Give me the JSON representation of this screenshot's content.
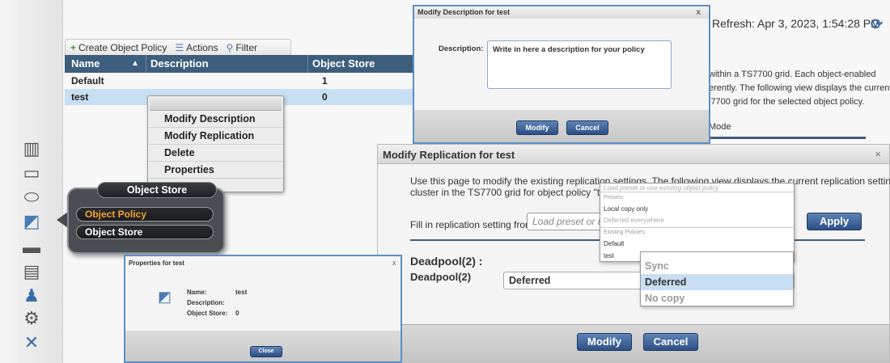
{
  "left_nav": {
    "icons": [
      "cluster-icon",
      "monitor-icon",
      "disk-icon",
      "object-store-icon",
      "tape-drive-icon",
      "clipboard-icon",
      "user-icon",
      "gears-icon",
      "tools-icon"
    ],
    "glyphs": [
      "▥",
      "▭",
      "⬭",
      "◩",
      "▬",
      "▤",
      "♟",
      "⚙",
      "✕"
    ]
  },
  "toolbar": {
    "create_label": "Create Object Policy",
    "actions_label": "Actions",
    "filter_label": "Filter",
    "create_glyph": "+",
    "actions_glyph": "☰",
    "filter_glyph": "⚲"
  },
  "grid": {
    "columns": [
      "Name",
      "Description",
      "Object Store"
    ],
    "sort_glyph": "▲",
    "rows": [
      {
        "name": "Default",
        "description": "",
        "object_store": "1"
      },
      {
        "name": "test",
        "description": "",
        "object_store": "0"
      }
    ]
  },
  "context_menu": {
    "items": [
      "Modify Description",
      "Modify Replication",
      "Delete",
      "Properties"
    ]
  },
  "object_store_popup": {
    "title": "Object Store",
    "items": [
      "Object Policy",
      "Object Store"
    ],
    "active_color": "#f2a531"
  },
  "background_panel": {
    "refresh_text": "Refresh:  Apr 3, 2023, 1:54:28 PM",
    "refresh_glyph": "⟳",
    "line1": "within a TS7700 grid. Each object-enabled",
    "line2": "erently. The following view displays the current",
    "line3": "i7700 grid for the selected object policy.",
    "mode_label": "Mode"
  },
  "modify_description_dialog": {
    "title": "Modify Description for test",
    "close_glyph": "x",
    "label": "Description:",
    "value": "Write in here a description for your policy",
    "modify_label": "Modify",
    "cancel_label": "Cancel"
  },
  "modify_replication_dialog": {
    "title": "Modify Replication for test",
    "close_glyph": "×",
    "intro_line1": "Use this page to modify the existing replication settings. The following view displays the current replication settings for each",
    "intro_line2": "cluster in the TS7700 grid for object policy \"test\"",
    "fill_label": "Fill in replication setting from",
    "fill_placeholder": "Load preset or use",
    "apply_label": "Apply",
    "cluster_title": "Deadpool(2) :",
    "cluster_label": "Deadpool(2)",
    "cluster_value": "Deferred",
    "modify_label": "Modify",
    "cancel_label": "Cancel"
  },
  "preset_dropdown": {
    "hint": "Load preset or use existing object policy",
    "presets_header": "Presets:",
    "presets": [
      "Local copy only",
      "Deferred everywhere"
    ],
    "policies_header": "Existing Policies:",
    "policies": [
      "Default",
      "test"
    ]
  },
  "sync_dropdown": {
    "options": [
      "Sync",
      "Deferred",
      "No copy"
    ],
    "selected": "Deferred"
  },
  "properties_dialog": {
    "title": "Properties for test",
    "close_glyph": "x",
    "icon_glyph": "◩",
    "fields": [
      {
        "key": "Name:",
        "value": "test"
      },
      {
        "key": "Description:",
        "value": ""
      },
      {
        "key": "Object Store:",
        "value": "0"
      }
    ],
    "close_label": "Close"
  },
  "colors": {
    "accent_blue": "#3e5e7d",
    "selection": "#c8dff3",
    "button_blue": "#2d4f86",
    "dialog_border": "#5b8fc4"
  }
}
